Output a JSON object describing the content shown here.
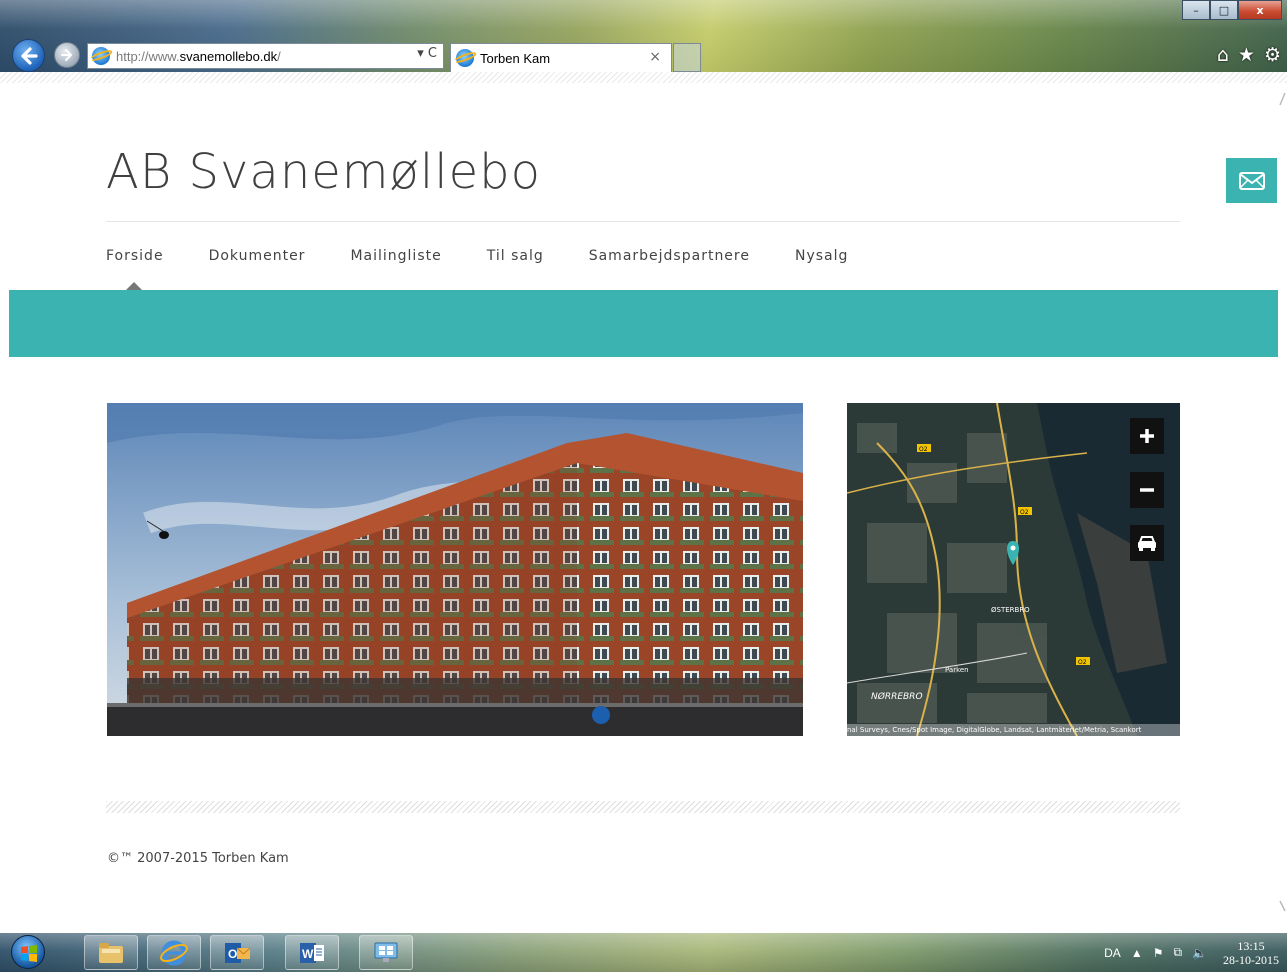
{
  "browser": {
    "url_prefix": "http://www.",
    "url_domain": "svanemollebo.dk",
    "url_suffix": "/",
    "address_controls": "▾ C",
    "tab_title": "Torben Kam",
    "tab_close": "×",
    "window_buttons": {
      "minimize": "–",
      "maximize": "□",
      "close": "x"
    }
  },
  "site": {
    "title": "AB Svanemøllebo",
    "nav": [
      {
        "label": "Forside",
        "active": true
      },
      {
        "label": "Dokumenter"
      },
      {
        "label": "Mailingliste"
      },
      {
        "label": "Til salg"
      },
      {
        "label": "Samarbejdspartnere"
      },
      {
        "label": "Nysalg"
      }
    ],
    "accent_color": "#3ab3b1"
  },
  "map": {
    "labels": {
      "o2_a": "O2",
      "o2_b": "O2",
      "o2_c": "O2",
      "osterbro": "ØSTERBRO",
      "parken": "Parken",
      "norrebro": "NØRREBRO"
    },
    "attribution": "nal Surveys, Cnes/Spot Image, DigitalGlobe, Landsat, Lantmäteriet/Metria, Scankort"
  },
  "footer": {
    "copyright": "©™ 2007-2015 Torben Kam"
  },
  "taskbar": {
    "language": "DA",
    "time": "13:15",
    "date": "28-10-2015"
  }
}
